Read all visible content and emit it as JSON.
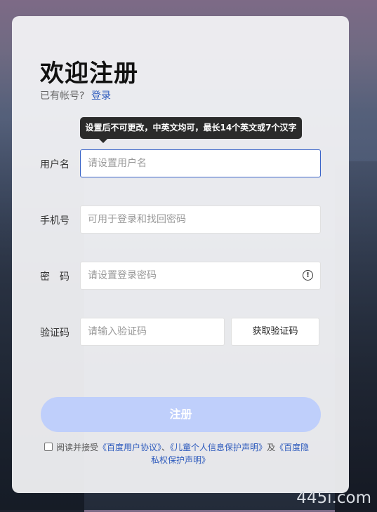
{
  "title": "欢迎注册",
  "account": {
    "prompt": "已有帐号?",
    "login_link": "登录"
  },
  "tooltip": "设置后不可更改，中英文均可，最长14个英文或7个汉字",
  "fields": {
    "username": {
      "label": "用户名",
      "placeholder": "请设置用户名"
    },
    "phone": {
      "label": "手机号",
      "placeholder": "可用于登录和找回密码"
    },
    "password": {
      "label": "密　码",
      "placeholder": "请设置登录密码"
    },
    "code": {
      "label": "验证码",
      "placeholder": "请输入验证码"
    }
  },
  "get_code_button": "获取验证码",
  "register_button": "注册",
  "agreement": {
    "prefix": "阅读并接受",
    "link1": "《百度用户协议》",
    "sep": "、",
    "link2": "《儿童个人信息保护声明》",
    "and": "及",
    "link3_part1": "《百度隐",
    "link3_part2": "私权保护声明》"
  },
  "watermark": "445i.com",
  "colors": {
    "accent": "#2e5bbd",
    "register_button": "#bfcffb",
    "focus_border": "#3a64c8"
  }
}
